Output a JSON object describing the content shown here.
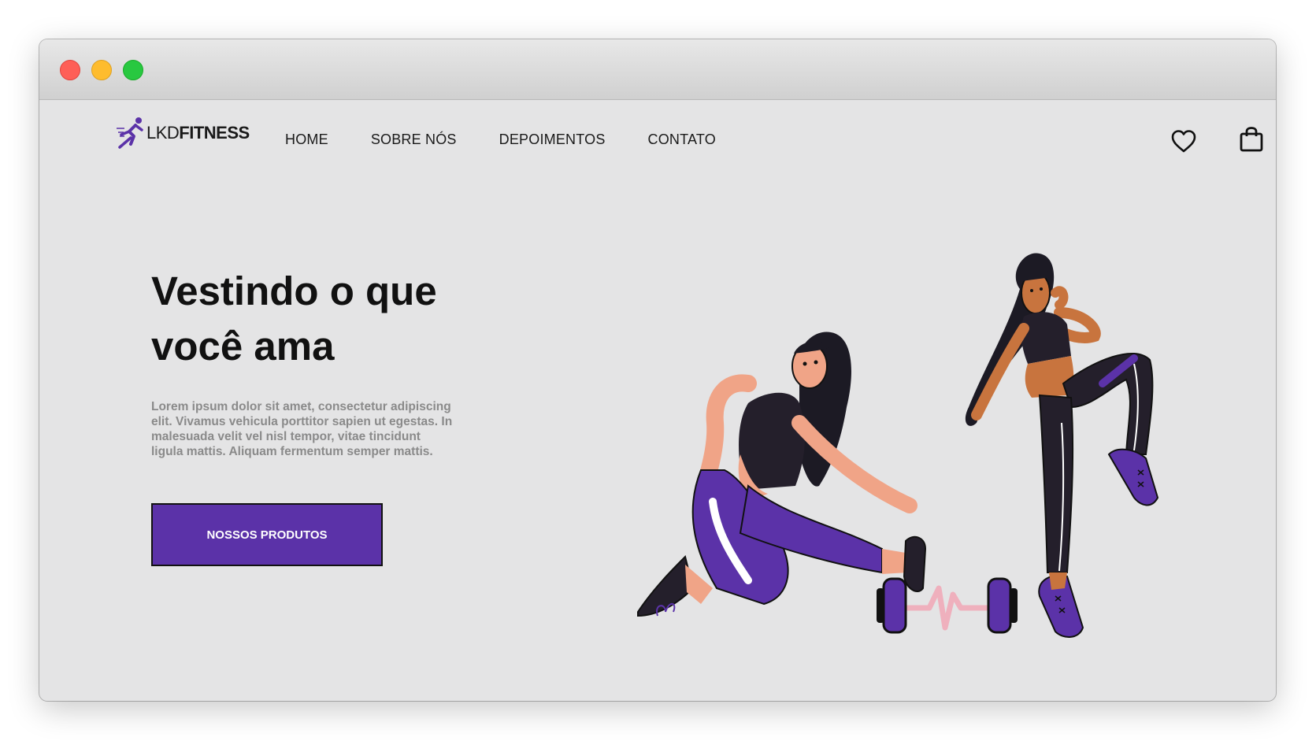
{
  "brand": {
    "logo_light": "LKD",
    "logo_bold": "FITNESS",
    "accent_color": "#5b32a8"
  },
  "nav": {
    "items": [
      {
        "label": "HOME"
      },
      {
        "label": "SOBRE NÓS"
      },
      {
        "label": "DEPOIMENTOS"
      },
      {
        "label": "CONTATO"
      }
    ],
    "icons": [
      "heart-icon",
      "shopping-bag-icon"
    ]
  },
  "hero": {
    "title_line1": "Vestindo o que",
    "title_line2": "você ama",
    "description": "Lorem ipsum dolor sit amet, consectetur adipiscing elit. Vivamus vehicula porttitor sapien ut egestas. In malesuada velit vel nisl tempor, vitae tincidunt ligula mattis. Aliquam fermentum semper mattis.",
    "cta_label": "NOSSOS PRODUTOS"
  }
}
